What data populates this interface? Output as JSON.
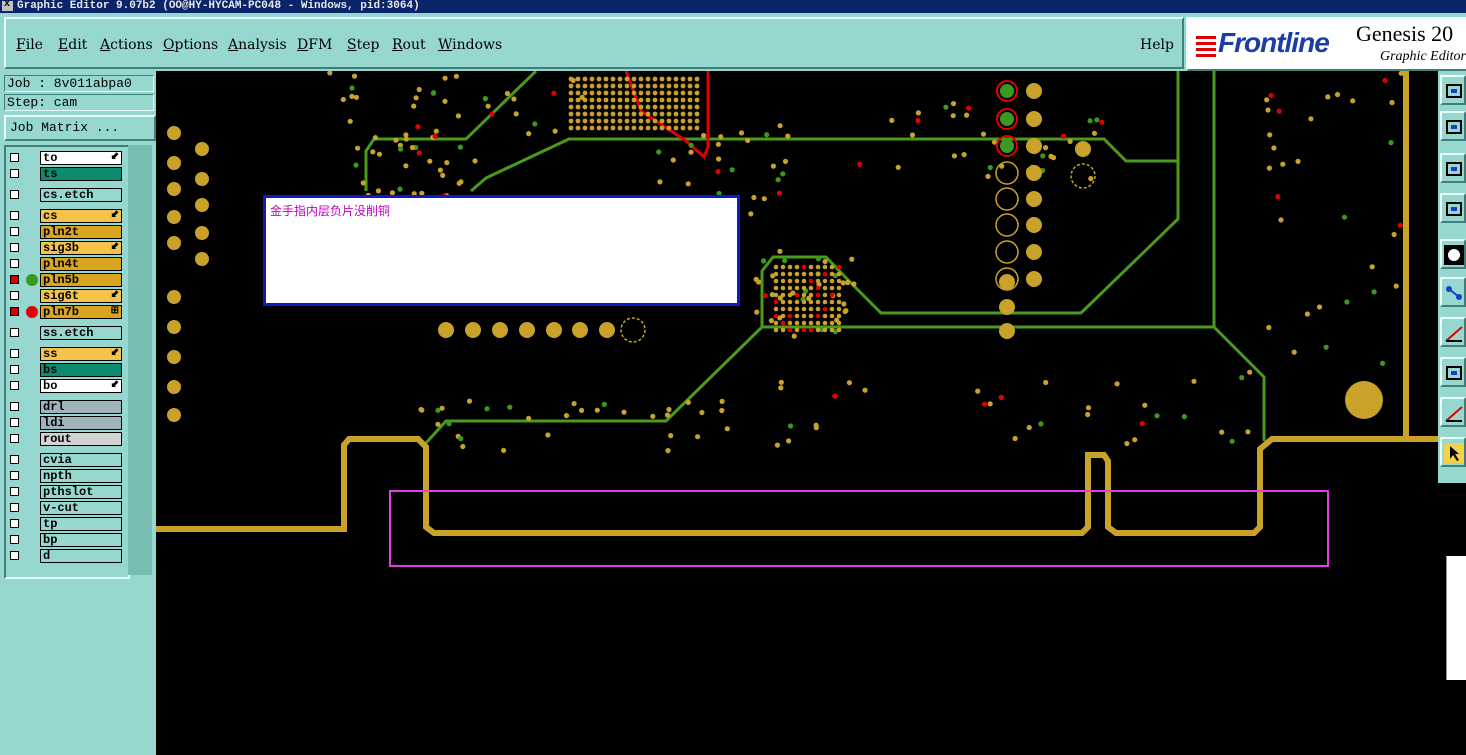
{
  "window": {
    "title": "Graphic Editor 9.07b2 (OO@HY-HYCAM-PC048 - Windows, pid:3064)"
  },
  "menu": {
    "items": [
      {
        "label": "File",
        "mn": "F",
        "rest": "ile"
      },
      {
        "label": "Edit",
        "mn": "E",
        "rest": "dit"
      },
      {
        "label": "Actions",
        "mn": "A",
        "rest": "ctions"
      },
      {
        "label": "Options",
        "mn": "O",
        "rest": "ptions"
      },
      {
        "label": "Analysis",
        "mn": "A",
        "rest": "nalysis"
      },
      {
        "label": "DFM",
        "mn": "D",
        "rest": "FM"
      },
      {
        "label": "Step",
        "mn": "S",
        "rest": "tep"
      },
      {
        "label": "Rout",
        "mn": "R",
        "rest": "out"
      },
      {
        "label": "Windows",
        "mn": "W",
        "rest": "indows"
      }
    ],
    "help": "Help"
  },
  "branding": {
    "logo": "Frontline",
    "product": "Genesis 20",
    "subtitle": "Graphic Editor"
  },
  "job": {
    "job_line": "Job : 8v011abpa0",
    "step_line": "Step: cam",
    "matrix_button": "Job Matrix ..."
  },
  "layers": [
    {
      "name": "to",
      "color": "#ffffff",
      "mark": "⬋",
      "cb": "empty",
      "dot": null
    },
    {
      "name": "ts",
      "color": "#0e8a6e",
      "mark": "",
      "cb": "empty",
      "dot": null
    },
    {
      "name": "cs.etch",
      "color": "#96d8d0",
      "mark": "",
      "cb": "empty",
      "dot": null
    },
    {
      "name": "cs",
      "color": "#f5c34a",
      "mark": "⬋",
      "cb": "empty",
      "dot": null
    },
    {
      "name": "pln2t",
      "color": "#d9a520",
      "mark": "",
      "cb": "empty",
      "dot": null
    },
    {
      "name": "sig3b",
      "color": "#f5c34a",
      "mark": "⬋",
      "cb": "empty",
      "dot": null
    },
    {
      "name": "pln4t",
      "color": "#d9a520",
      "mark": "",
      "cb": "empty",
      "dot": null
    },
    {
      "name": "pln5b",
      "color": "#d9a520",
      "mark": "",
      "cb": "filled",
      "dot": "#3a9a1e"
    },
    {
      "name": "sig6t",
      "color": "#f5c34a",
      "mark": "⬋",
      "cb": "empty",
      "dot": null
    },
    {
      "name": "pln7b",
      "color": "#d9a520",
      "mark": "⊞",
      "cb": "filled",
      "dot": "#e00000"
    },
    {
      "name": "ss.etch",
      "color": "#96d8d0",
      "mark": "",
      "cb": "empty",
      "dot": null
    },
    {
      "name": "ss",
      "color": "#f5c34a",
      "mark": "⬋",
      "cb": "empty",
      "dot": null
    },
    {
      "name": "bs",
      "color": "#0e8a6e",
      "mark": "",
      "cb": "empty",
      "dot": null
    },
    {
      "name": "bo",
      "color": "#ffffff",
      "mark": "⬋",
      "cb": "empty",
      "dot": null
    },
    {
      "name": "drl",
      "color": "#9fb3bd",
      "mark": "",
      "cb": "empty",
      "dot": null
    },
    {
      "name": "ldi",
      "color": "#9fb3bd",
      "mark": "",
      "cb": "empty",
      "dot": null
    },
    {
      "name": "rout",
      "color": "#d3d3d3",
      "mark": "",
      "cb": "empty",
      "dot": null
    },
    {
      "name": "cvia",
      "color": "#96d8d0",
      "mark": "",
      "cb": "empty",
      "dot": null
    },
    {
      "name": "npth",
      "color": "#96d8d0",
      "mark": "",
      "cb": "empty",
      "dot": null
    },
    {
      "name": "pthslot",
      "color": "#96d8d0",
      "mark": "",
      "cb": "empty",
      "dot": null
    },
    {
      "name": "v-cut",
      "color": "#96d8d0",
      "mark": "",
      "cb": "empty",
      "dot": null
    },
    {
      "name": "tp",
      "color": "#96d8d0",
      "mark": "",
      "cb": "empty",
      "dot": null
    },
    {
      "name": "bp",
      "color": "#96d8d0",
      "mark": "",
      "cb": "empty",
      "dot": null
    },
    {
      "name": "d",
      "color": "#96d8d0",
      "mark": "",
      "cb": "empty",
      "dot": null
    }
  ],
  "note": {
    "text": "金手指内层负片没削铜"
  },
  "tools": [
    "zoom-fit-icon",
    "move-icon",
    "resize-icon",
    "measure-icon",
    "circle-icon",
    "net-icon",
    "triangle-icon",
    "snap-icon",
    "delta-icon",
    "pointer-icon"
  ],
  "colors": {
    "copper": "#c9a22a",
    "trace": "#4a9a1c",
    "via_red": "#e00000",
    "via_green": "#3a9a1e",
    "highlight": "#e040e0",
    "panel": "#96d8d0"
  }
}
